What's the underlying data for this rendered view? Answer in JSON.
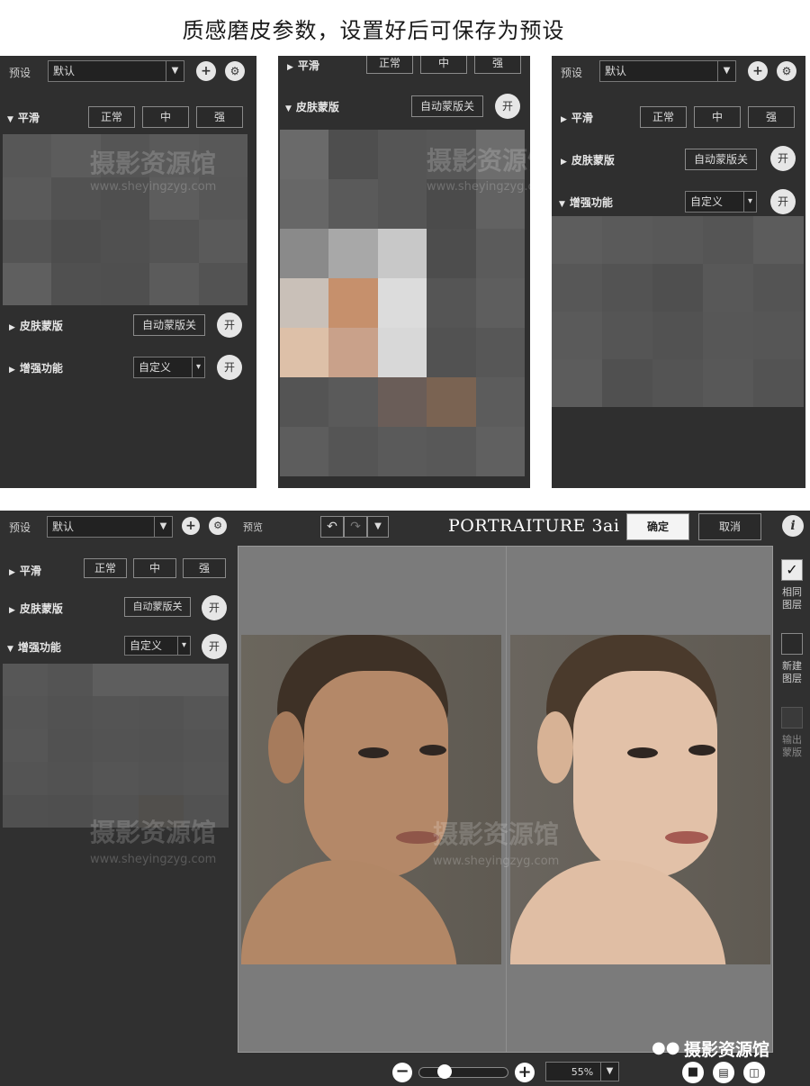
{
  "title": "质感磨皮参数，设置好后可保存为预设",
  "panel1": {
    "preset_label": "预设",
    "preset_value": "默认",
    "smooth_label": "平滑",
    "btn_normal": "正常",
    "btn_medium": "中",
    "btn_strong": "强",
    "skin_mask_label": "皮肤蒙版",
    "auto_mask_btn": "自动蒙版关",
    "on_label": "开",
    "enhance_label": "增强功能",
    "custom_select": "自定义"
  },
  "panel2": {
    "smooth_label": "平滑",
    "btn_normal": "正常",
    "btn_medium": "中",
    "btn_strong": "强",
    "skin_mask_label": "皮肤蒙版",
    "auto_mask_btn": "自动蒙版关",
    "on_label": "开"
  },
  "panel3": {
    "preset_label": "预设",
    "preset_value": "默认",
    "smooth_label": "平滑",
    "btn_normal": "正常",
    "btn_medium": "中",
    "btn_strong": "强",
    "skin_mask_label": "皮肤蒙版",
    "auto_mask_btn": "自动蒙版关",
    "on_label": "开",
    "enhance_label": "增强功能",
    "custom_select": "自定义"
  },
  "app": {
    "preset_label": "预设",
    "preset_value": "默认",
    "preview_label": "预览",
    "app_title": "PORTRAITURE 3ai",
    "ok_button": "确定",
    "cancel_button": "取消",
    "info_icon": "i",
    "smooth_label": "平滑",
    "btn_normal": "正常",
    "btn_medium": "中",
    "btn_strong": "强",
    "skin_mask_label": "皮肤蒙版",
    "auto_mask_btn": "自动蒙版关",
    "on_label": "开",
    "enhance_label": "增强功能",
    "custom_select": "自定义",
    "same_layer": "相同图层",
    "new_layer": "新建图层",
    "output_mask": "输出蒙版",
    "zoom_value": "55%"
  },
  "watermark": {
    "cn": "摄影资源馆",
    "url": "www.sheyingzyg.com"
  },
  "brand": {
    "wechat_name": "摄影资源馆"
  }
}
